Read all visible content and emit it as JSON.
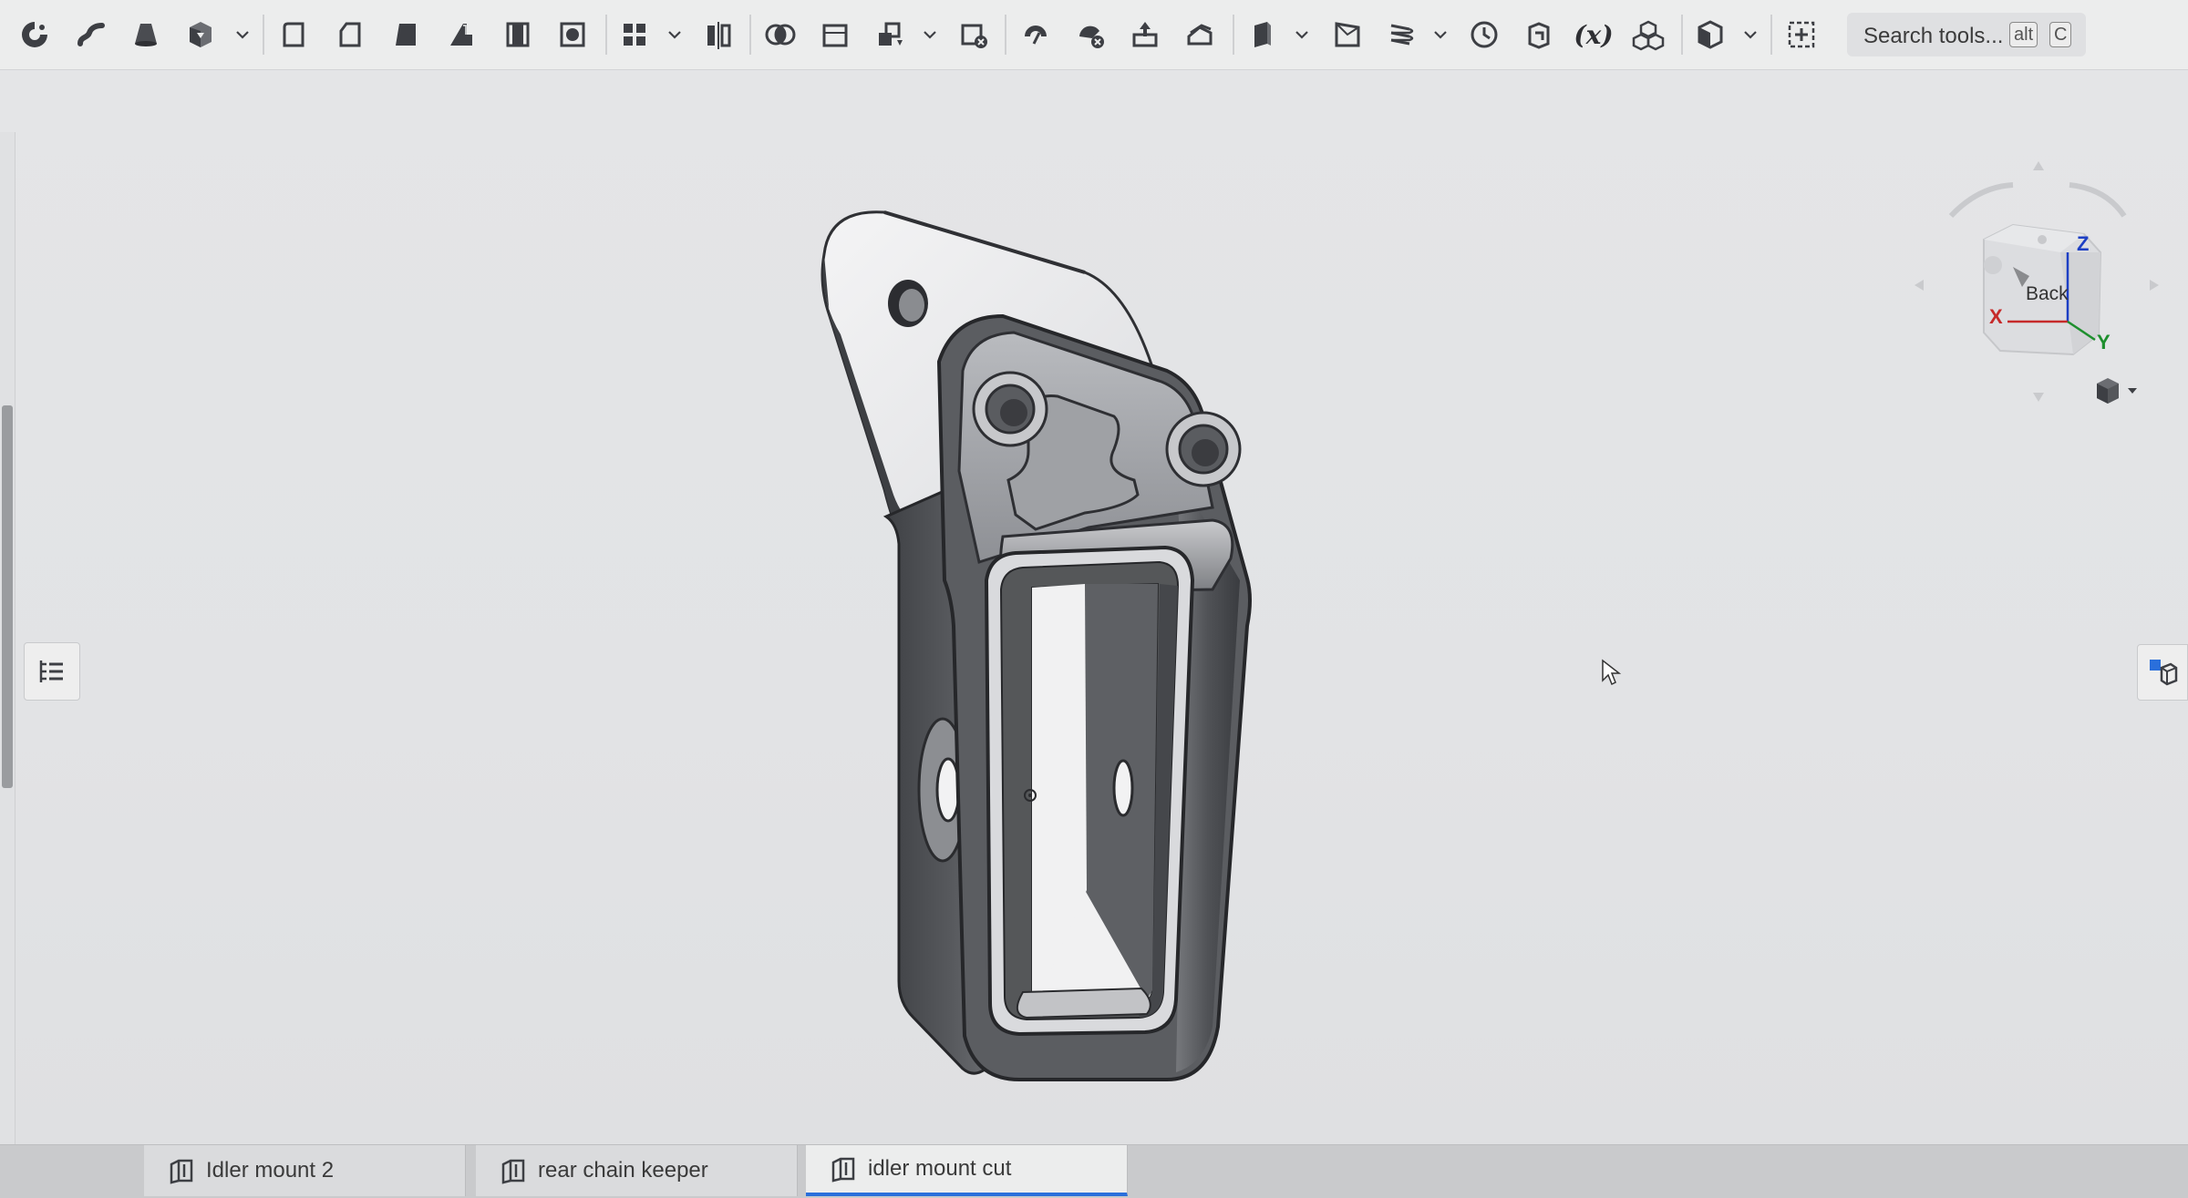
{
  "toolbar": {
    "icons": [
      "sketch-icon",
      "extrude-icon",
      "revolve-icon",
      "sweep-icon",
      "loft-icon",
      "thicken-icon",
      "fillet-icon",
      "chamfer-icon",
      "draft-icon",
      "rib-icon",
      "shell-icon",
      "hole-icon",
      "linear-pattern-icon",
      "mirror-icon",
      "boolean-icon",
      "split-icon",
      "transform-icon",
      "delete-part-icon",
      "modify-fillet-icon",
      "delete-face-icon",
      "move-face-icon",
      "replace-face-icon",
      "plane-icon",
      "mate-connector-icon",
      "helix-icon",
      "sheet-metal-icon",
      "variable-icon",
      "assembly-icon",
      "section-view-icon",
      "insert-icon"
    ],
    "variable_symbol": "(x)",
    "search": {
      "placeholder": "Search tools...",
      "shortcut_mod": "alt",
      "shortcut_key": "C"
    }
  },
  "viewcube": {
    "axis_z": "Z",
    "axis_x": "X",
    "axis_y": "Y",
    "face_label": "Back",
    "colors": {
      "z": "#1d3fc4",
      "x": "#c62a2a",
      "y": "#1e8f2e"
    }
  },
  "tabs": [
    {
      "label": "Idler mount 2",
      "active": false
    },
    {
      "label": "rear chain keeper",
      "active": false
    },
    {
      "label": "idler mount cut",
      "active": true
    }
  ],
  "colors": {
    "accent": "#2a6fdb",
    "part_shade": "#55575b",
    "background": "#e3e4e6"
  }
}
